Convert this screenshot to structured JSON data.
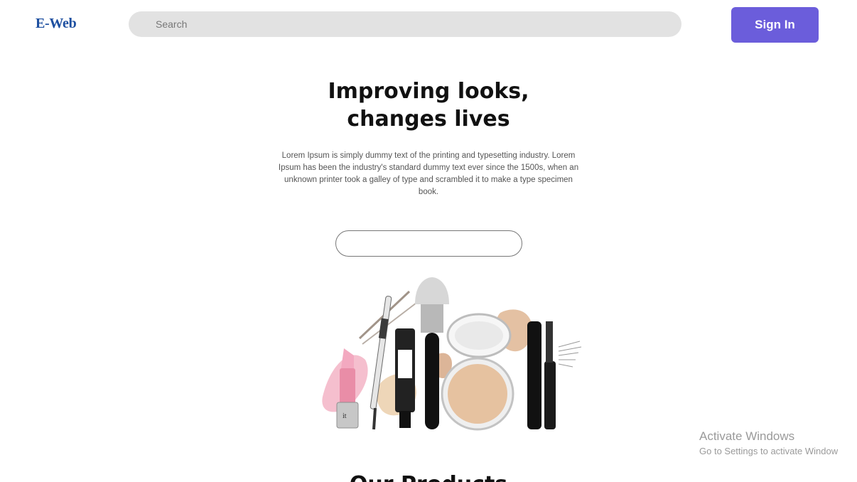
{
  "header": {
    "brand": "E-Web",
    "search": {
      "placeholder": "Search"
    },
    "signin_label": "Sign In"
  },
  "hero": {
    "title_line1": "Improving looks,",
    "title_line2": "changes lives",
    "description": "Lorem Ipsum is simply dummy text of the printing and typesetting industry. Lorem Ipsum has been the industry's standard dummy text ever since the 1500s, when an unknown printer took a galley of type and scrambled it to make a type specimen book.",
    "input_value": ""
  },
  "products_section": {
    "title": "Our Products"
  },
  "watermark": {
    "title": "Activate Windows",
    "subtitle": "Go to Settings to activate Window"
  },
  "colors": {
    "brand": "#1d4fa0",
    "accent": "#6b5ddb",
    "search_bg": "#e2e2e2"
  }
}
